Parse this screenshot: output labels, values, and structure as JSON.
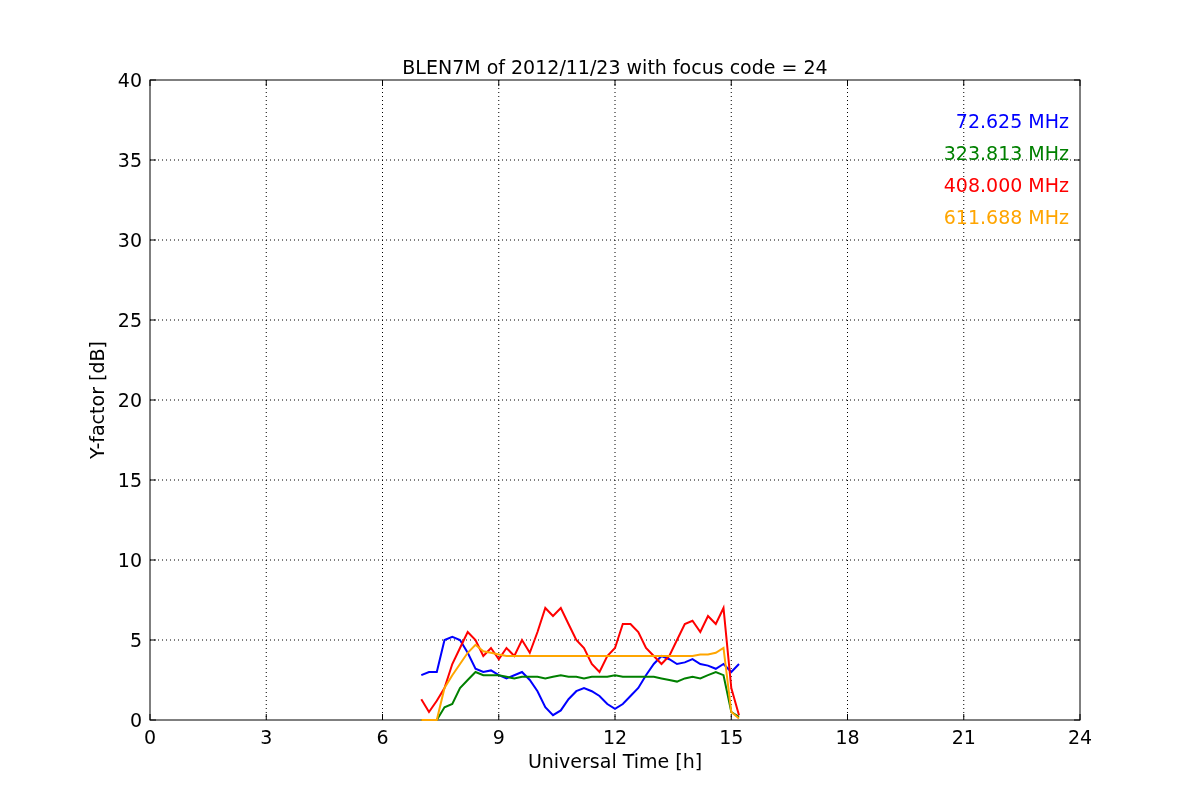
{
  "figure": {
    "chart_data": {
      "type": "line",
      "title": "BLEN7M of 2012/11/23 with focus code = 24",
      "xlabel": "Universal Time [h]",
      "ylabel": "Y-factor [dB]",
      "x": [
        7.0,
        7.2,
        7.4,
        7.6,
        7.8,
        8.0,
        8.2,
        8.4,
        8.6,
        8.8,
        9.0,
        9.2,
        9.4,
        9.6,
        9.8,
        10.0,
        10.2,
        10.4,
        10.6,
        10.8,
        11.0,
        11.2,
        11.4,
        11.6,
        11.8,
        12.0,
        12.2,
        12.4,
        12.6,
        12.8,
        13.0,
        13.2,
        13.4,
        13.6,
        13.8,
        14.0,
        14.2,
        14.4,
        14.6,
        14.8,
        15.0,
        15.2
      ],
      "series": [
        {
          "name": "72.625 MHz",
          "color": "#0000ff",
          "values": [
            2.8,
            3.0,
            3.0,
            5.0,
            5.2,
            5.0,
            4.2,
            3.2,
            3.0,
            3.1,
            2.8,
            2.6,
            2.8,
            3.0,
            2.5,
            1.8,
            0.8,
            0.3,
            0.6,
            1.3,
            1.8,
            2.0,
            1.8,
            1.5,
            1.0,
            0.7,
            1.0,
            1.5,
            2.0,
            2.8,
            3.5,
            4.0,
            3.8,
            3.5,
            3.6,
            3.8,
            3.5,
            3.4,
            3.2,
            3.5,
            3.0,
            3.5
          ]
        },
        {
          "name": "323.813 MHz",
          "color": "#008000",
          "values": [
            0,
            0,
            0,
            0.8,
            1.0,
            2.0,
            2.5,
            3.0,
            2.8,
            2.8,
            2.8,
            2.7,
            2.6,
            2.7,
            2.7,
            2.7,
            2.6,
            2.7,
            2.8,
            2.7,
            2.7,
            2.6,
            2.7,
            2.7,
            2.7,
            2.8,
            2.7,
            2.7,
            2.7,
            2.7,
            2.7,
            2.6,
            2.5,
            2.4,
            2.6,
            2.7,
            2.6,
            2.8,
            3.0,
            2.8,
            0.5,
            0.2
          ]
        },
        {
          "name": "408.000 MHz",
          "color": "#ff0000",
          "values": [
            1.3,
            0.5,
            1.2,
            2.0,
            3.5,
            4.5,
            5.5,
            5.0,
            4.0,
            4.5,
            3.8,
            4.5,
            4.0,
            5.0,
            4.2,
            5.5,
            7.0,
            6.5,
            7.0,
            6.0,
            5.0,
            4.5,
            3.5,
            3.0,
            4.0,
            4.5,
            6.0,
            6.0,
            5.5,
            4.5,
            4.0,
            3.5,
            4.0,
            5.0,
            6.0,
            6.2,
            5.5,
            6.5,
            6.0,
            7.0,
            2.0,
            0.3
          ]
        },
        {
          "name": "611.688 MHz",
          "color": "#ffa500",
          "values": [
            0,
            0,
            0,
            2.0,
            2.8,
            3.5,
            4.2,
            4.7,
            4.3,
            4.2,
            4.1,
            4.0,
            4.0,
            4.0,
            4.0,
            4.0,
            4.0,
            4.0,
            4.0,
            4.0,
            4.0,
            4.0,
            4.0,
            4.0,
            4.0,
            4.0,
            4.0,
            4.0,
            4.0,
            4.0,
            4.0,
            4.0,
            4.0,
            4.0,
            4.0,
            4.0,
            4.1,
            4.1,
            4.2,
            4.5,
            0.5,
            0.1
          ]
        }
      ],
      "grid": true,
      "xlim": [
        0,
        24
      ],
      "ylim": [
        0,
        40
      ],
      "xticks": [
        0,
        3,
        6,
        9,
        12,
        15,
        18,
        21,
        24
      ],
      "yticks": [
        0,
        5,
        10,
        15,
        20,
        25,
        30,
        35,
        40
      ]
    }
  }
}
